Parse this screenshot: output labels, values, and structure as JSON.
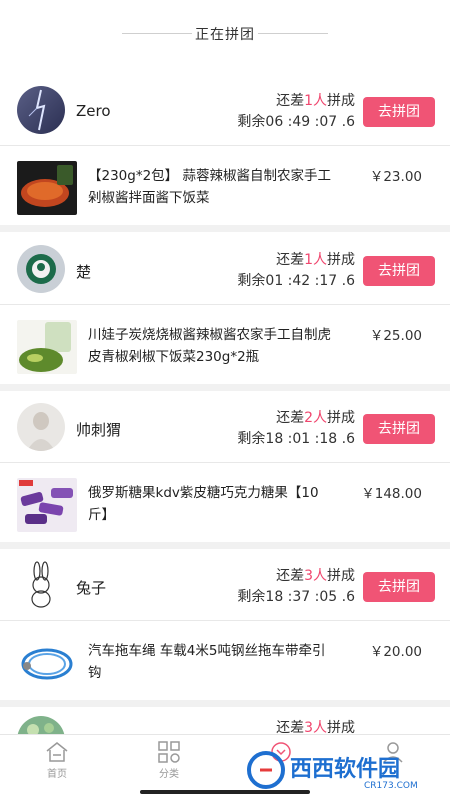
{
  "header": {
    "title": "正在拼团"
  },
  "groups": [
    {
      "user": "Zero",
      "status_prefix": "还差",
      "count": "1人",
      "status_suffix": "拼成",
      "timer": "剩余06 :49 :07 .6",
      "button": "去拼团",
      "product_name": "【230g*2包】 蒜蓉辣椒酱自制农家手工剁椒酱拌面酱下饭菜",
      "price": "￥23.00"
    },
    {
      "user": "楚",
      "status_prefix": "还差",
      "count": "1人",
      "status_suffix": "拼成",
      "timer": "剩余01 :42 :17 .6",
      "button": "去拼团",
      "product_name": "川娃子炭烧烧椒酱辣椒酱农家手工自制虎皮青椒剁椒下饭菜230g*2瓶",
      "price": "￥25.00"
    },
    {
      "user": "帅刺猬",
      "status_prefix": "还差",
      "count": "2人",
      "status_suffix": "拼成",
      "timer": "剩余18 :01 :18 .6",
      "button": "去拼团",
      "product_name": "俄罗斯糖果kdv紫皮糖巧克力糖果【10斤】",
      "price": "￥148.00"
    },
    {
      "user": "兔子",
      "status_prefix": "还差",
      "count": "3人",
      "status_suffix": "拼成",
      "timer": "剩余18 :37 :05 .6",
      "button": "去拼团",
      "product_name": "汽车拖车绳 车载4米5吨钢丝拖车带牵引钩",
      "price": "￥20.00"
    },
    {
      "user": "",
      "status_prefix": "还差",
      "count": "3人",
      "status_suffix": "拼成",
      "timer": "",
      "button": "",
      "product_name": "",
      "price": ""
    }
  ],
  "tabs": [
    {
      "label": "首页",
      "icon": "home-icon"
    },
    {
      "label": "分类",
      "icon": "category-icon"
    },
    {
      "label": "",
      "icon": "cart-icon"
    },
    {
      "label": "",
      "icon": "user-icon"
    }
  ],
  "watermark": {
    "brand": "西西软件园",
    "domain": "CR173.COM"
  },
  "colors": {
    "accent": "#f05475",
    "highlight": "#f0466e"
  }
}
